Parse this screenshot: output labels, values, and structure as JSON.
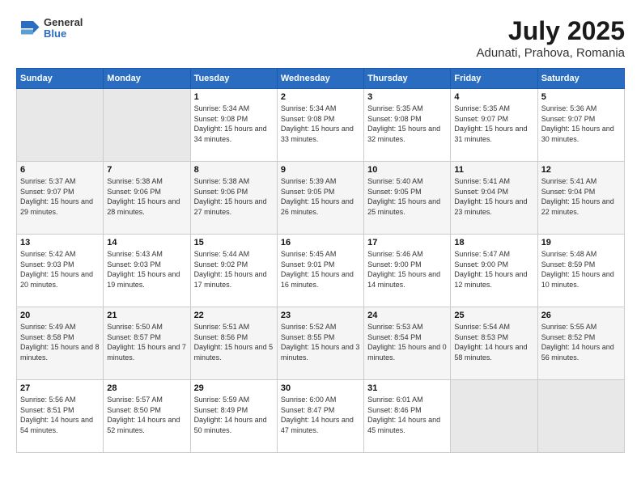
{
  "header": {
    "logo": {
      "line1": "General",
      "line2": "Blue"
    },
    "title": "July 2025",
    "subtitle": "Adunati, Prahova, Romania"
  },
  "weekdays": [
    "Sunday",
    "Monday",
    "Tuesday",
    "Wednesday",
    "Thursday",
    "Friday",
    "Saturday"
  ],
  "weeks": [
    [
      {
        "day": "",
        "empty": true
      },
      {
        "day": "",
        "empty": true
      },
      {
        "day": "1",
        "sunrise": "5:34 AM",
        "sunset": "9:08 PM",
        "daylight": "15 hours and 34 minutes."
      },
      {
        "day": "2",
        "sunrise": "5:34 AM",
        "sunset": "9:08 PM",
        "daylight": "15 hours and 33 minutes."
      },
      {
        "day": "3",
        "sunrise": "5:35 AM",
        "sunset": "9:08 PM",
        "daylight": "15 hours and 32 minutes."
      },
      {
        "day": "4",
        "sunrise": "5:35 AM",
        "sunset": "9:07 PM",
        "daylight": "15 hours and 31 minutes."
      },
      {
        "day": "5",
        "sunrise": "5:36 AM",
        "sunset": "9:07 PM",
        "daylight": "15 hours and 30 minutes."
      }
    ],
    [
      {
        "day": "6",
        "sunrise": "5:37 AM",
        "sunset": "9:07 PM",
        "daylight": "15 hours and 29 minutes."
      },
      {
        "day": "7",
        "sunrise": "5:38 AM",
        "sunset": "9:06 PM",
        "daylight": "15 hours and 28 minutes."
      },
      {
        "day": "8",
        "sunrise": "5:38 AM",
        "sunset": "9:06 PM",
        "daylight": "15 hours and 27 minutes."
      },
      {
        "day": "9",
        "sunrise": "5:39 AM",
        "sunset": "9:05 PM",
        "daylight": "15 hours and 26 minutes."
      },
      {
        "day": "10",
        "sunrise": "5:40 AM",
        "sunset": "9:05 PM",
        "daylight": "15 hours and 25 minutes."
      },
      {
        "day": "11",
        "sunrise": "5:41 AM",
        "sunset": "9:04 PM",
        "daylight": "15 hours and 23 minutes."
      },
      {
        "day": "12",
        "sunrise": "5:41 AM",
        "sunset": "9:04 PM",
        "daylight": "15 hours and 22 minutes."
      }
    ],
    [
      {
        "day": "13",
        "sunrise": "5:42 AM",
        "sunset": "9:03 PM",
        "daylight": "15 hours and 20 minutes."
      },
      {
        "day": "14",
        "sunrise": "5:43 AM",
        "sunset": "9:03 PM",
        "daylight": "15 hours and 19 minutes."
      },
      {
        "day": "15",
        "sunrise": "5:44 AM",
        "sunset": "9:02 PM",
        "daylight": "15 hours and 17 minutes."
      },
      {
        "day": "16",
        "sunrise": "5:45 AM",
        "sunset": "9:01 PM",
        "daylight": "15 hours and 16 minutes."
      },
      {
        "day": "17",
        "sunrise": "5:46 AM",
        "sunset": "9:00 PM",
        "daylight": "15 hours and 14 minutes."
      },
      {
        "day": "18",
        "sunrise": "5:47 AM",
        "sunset": "9:00 PM",
        "daylight": "15 hours and 12 minutes."
      },
      {
        "day": "19",
        "sunrise": "5:48 AM",
        "sunset": "8:59 PM",
        "daylight": "15 hours and 10 minutes."
      }
    ],
    [
      {
        "day": "20",
        "sunrise": "5:49 AM",
        "sunset": "8:58 PM",
        "daylight": "15 hours and 8 minutes."
      },
      {
        "day": "21",
        "sunrise": "5:50 AM",
        "sunset": "8:57 PM",
        "daylight": "15 hours and 7 minutes."
      },
      {
        "day": "22",
        "sunrise": "5:51 AM",
        "sunset": "8:56 PM",
        "daylight": "15 hours and 5 minutes."
      },
      {
        "day": "23",
        "sunrise": "5:52 AM",
        "sunset": "8:55 PM",
        "daylight": "15 hours and 3 minutes."
      },
      {
        "day": "24",
        "sunrise": "5:53 AM",
        "sunset": "8:54 PM",
        "daylight": "15 hours and 0 minutes."
      },
      {
        "day": "25",
        "sunrise": "5:54 AM",
        "sunset": "8:53 PM",
        "daylight": "14 hours and 58 minutes."
      },
      {
        "day": "26",
        "sunrise": "5:55 AM",
        "sunset": "8:52 PM",
        "daylight": "14 hours and 56 minutes."
      }
    ],
    [
      {
        "day": "27",
        "sunrise": "5:56 AM",
        "sunset": "8:51 PM",
        "daylight": "14 hours and 54 minutes."
      },
      {
        "day": "28",
        "sunrise": "5:57 AM",
        "sunset": "8:50 PM",
        "daylight": "14 hours and 52 minutes."
      },
      {
        "day": "29",
        "sunrise": "5:59 AM",
        "sunset": "8:49 PM",
        "daylight": "14 hours and 50 minutes."
      },
      {
        "day": "30",
        "sunrise": "6:00 AM",
        "sunset": "8:47 PM",
        "daylight": "14 hours and 47 minutes."
      },
      {
        "day": "31",
        "sunrise": "6:01 AM",
        "sunset": "8:46 PM",
        "daylight": "14 hours and 45 minutes."
      },
      {
        "day": "",
        "empty": true
      },
      {
        "day": "",
        "empty": true
      }
    ]
  ],
  "labels": {
    "sunrise": "Sunrise:",
    "sunset": "Sunset:",
    "daylight": "Daylight:"
  }
}
